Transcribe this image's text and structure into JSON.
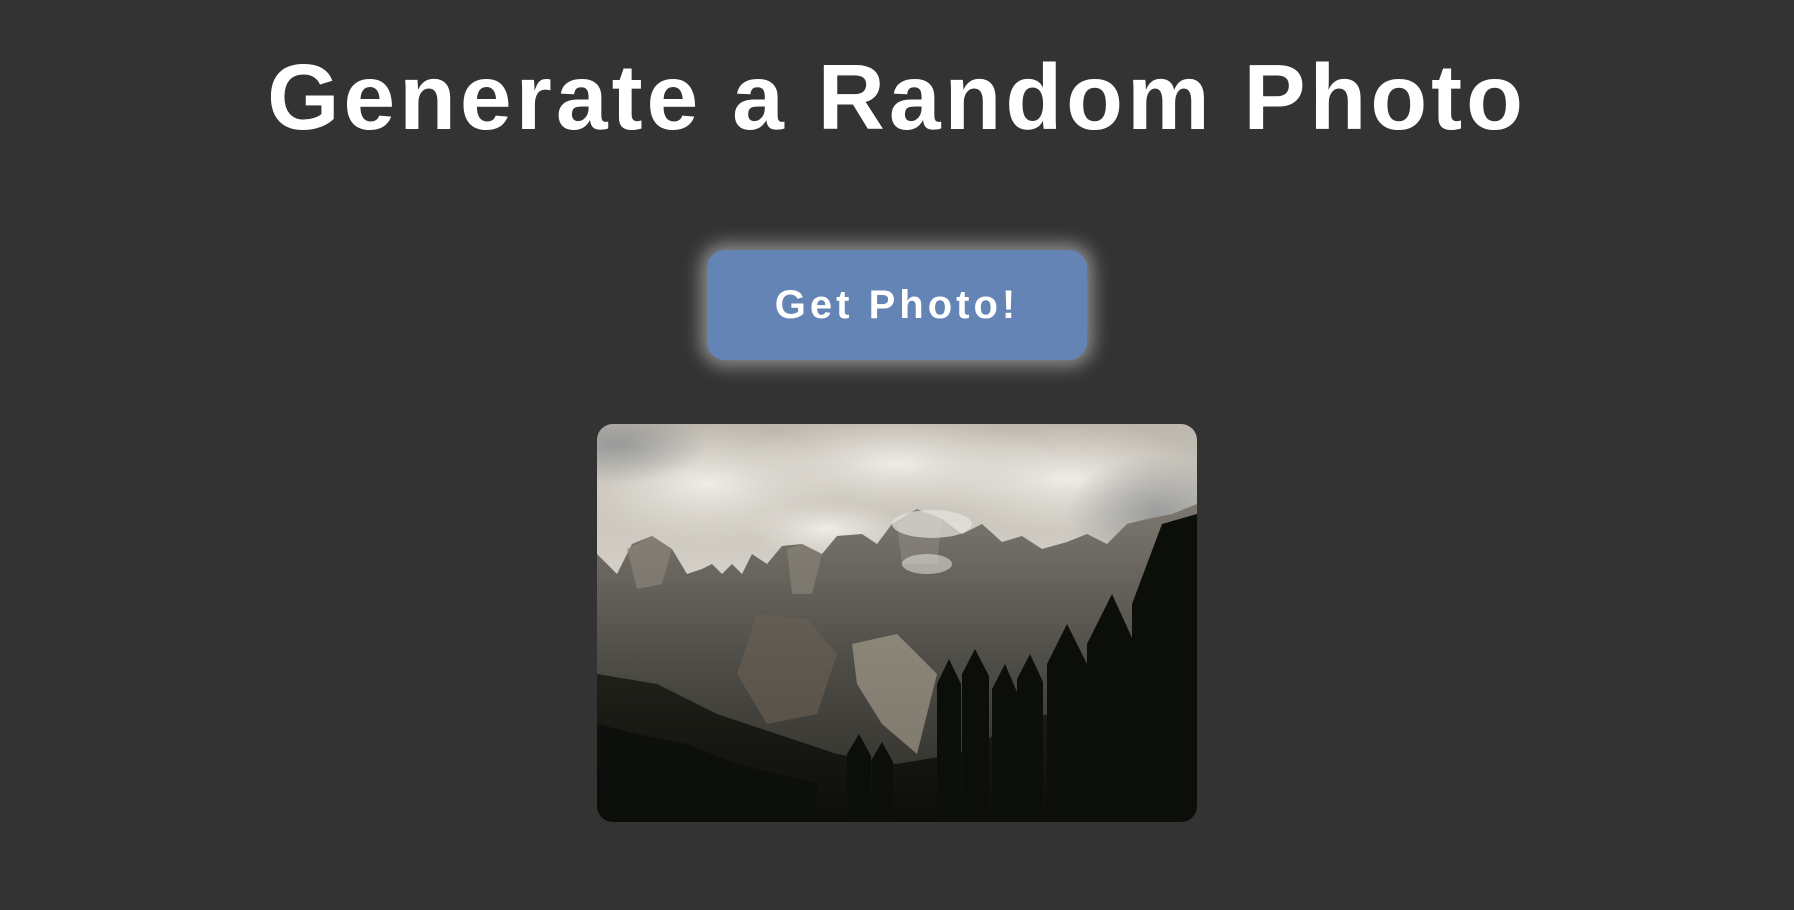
{
  "header": {
    "title": "Generate a Random Photo"
  },
  "actions": {
    "get_photo_label": "Get Photo!"
  },
  "photo": {
    "alt": "Mountain range with clouds and pine forest"
  },
  "colors": {
    "background": "#333333",
    "button": "#6384b5",
    "text": "#ffffff"
  }
}
